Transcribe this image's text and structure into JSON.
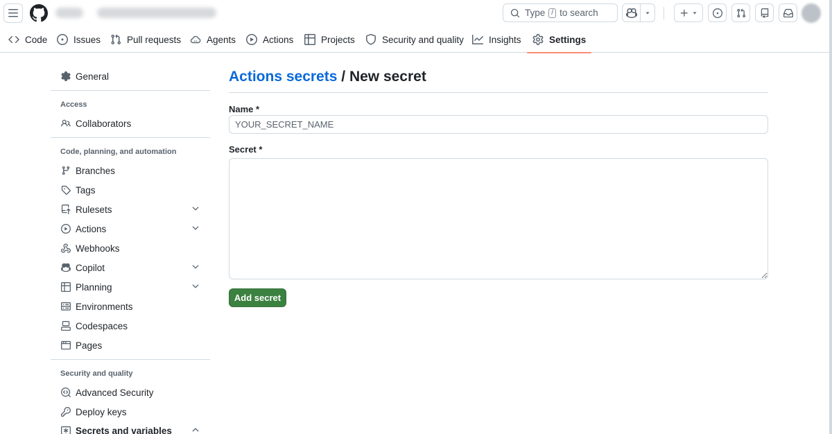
{
  "header": {
    "search": {
      "text_before": "Type",
      "kbd": "/",
      "text_after": "to search"
    }
  },
  "repo_nav": {
    "tabs": [
      {
        "label": "Code",
        "icon": "code-icon"
      },
      {
        "label": "Issues",
        "icon": "issue-opened-icon"
      },
      {
        "label": "Pull requests",
        "icon": "git-pull-request-icon"
      },
      {
        "label": "Agents",
        "icon": "agent-cloud-icon"
      },
      {
        "label": "Actions",
        "icon": "play-icon"
      },
      {
        "label": "Projects",
        "icon": "table-icon"
      },
      {
        "label": "Security and quality",
        "icon": "shield-icon"
      },
      {
        "label": "Insights",
        "icon": "graph-icon"
      },
      {
        "label": "Settings",
        "icon": "gear-icon",
        "selected": true
      }
    ]
  },
  "sidebar": {
    "general": "General",
    "access_heading": "Access",
    "collaborators": "Collaborators",
    "code_heading": "Code, planning, and automation",
    "items": [
      {
        "label": "Branches",
        "icon": "git-branch-icon"
      },
      {
        "label": "Tags",
        "icon": "tag-icon"
      },
      {
        "label": "Rulesets",
        "icon": "repo-push-icon",
        "expandable": true
      },
      {
        "label": "Actions",
        "icon": "play-icon",
        "expandable": true
      },
      {
        "label": "Webhooks",
        "icon": "webhook-icon"
      },
      {
        "label": "Copilot",
        "icon": "copilot-icon",
        "expandable": true
      },
      {
        "label": "Planning",
        "icon": "table-icon",
        "expandable": true
      },
      {
        "label": "Environments",
        "icon": "server-icon"
      },
      {
        "label": "Codespaces",
        "icon": "codespaces-icon"
      },
      {
        "label": "Pages",
        "icon": "browser-icon"
      }
    ],
    "security_heading": "Security and quality",
    "security_items": [
      {
        "label": "Advanced Security",
        "icon": "codescan-icon"
      },
      {
        "label": "Deploy keys",
        "icon": "key-icon"
      },
      {
        "label": "Secrets and variables",
        "icon": "asterisk-icon",
        "expanded": true
      }
    ]
  },
  "main": {
    "breadcrumb_link": "Actions secrets",
    "breadcrumb_separator": "/",
    "title": "New secret",
    "name_label": "Name *",
    "name_placeholder": "YOUR_SECRET_NAME",
    "secret_label": "Secret *",
    "secret_value": "",
    "submit_label": "Add secret"
  },
  "colors": {
    "link": "#0969da",
    "primary_button": "#3b8140",
    "selected_tab_underline": "#fd8c73",
    "border": "#d1d9e0"
  }
}
